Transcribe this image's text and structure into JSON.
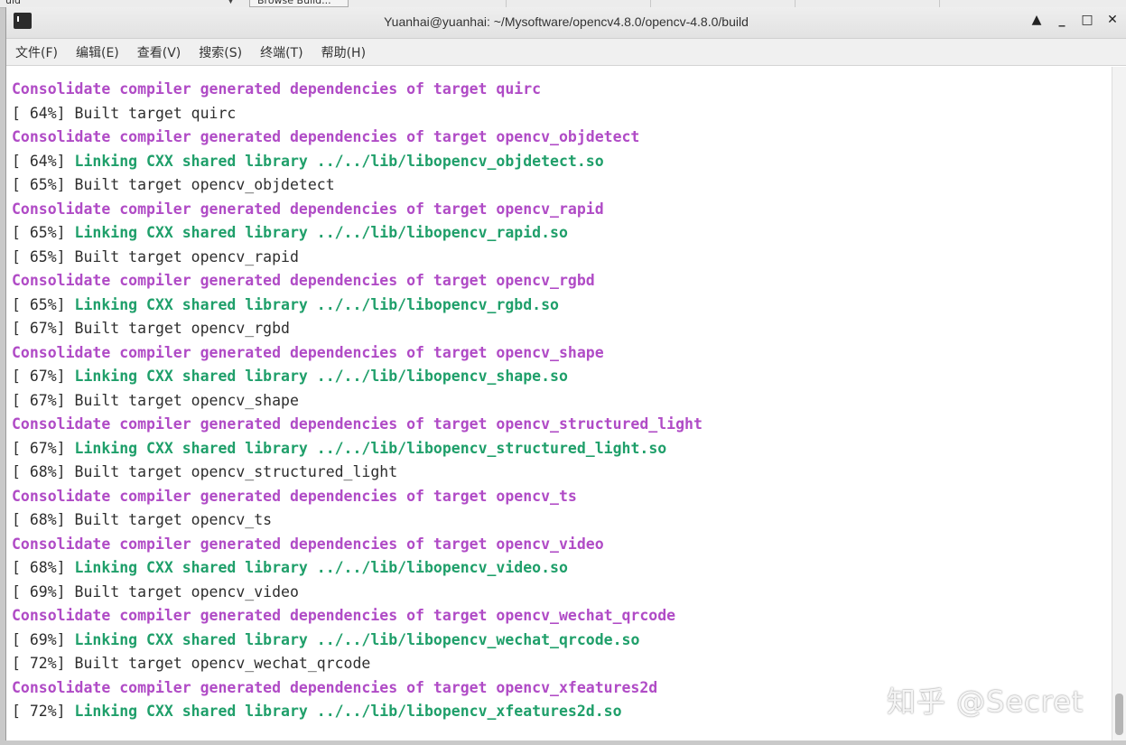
{
  "window": {
    "title": "Yuanhai@yuanhai: ~/Mysoftware/opencv4.8.0/opencv-4.8.0/build",
    "controls": {
      "shade": "▲",
      "minimize": "_",
      "maximize": "□",
      "close": "✕"
    }
  },
  "background_window": {
    "left_text": "uld",
    "button_label": "Browse Build..."
  },
  "menu": [
    {
      "label": "文件(F)"
    },
    {
      "label": "编辑(E)"
    },
    {
      "label": "查看(V)"
    },
    {
      "label": "搜索(S)"
    },
    {
      "label": "终端(T)"
    },
    {
      "label": "帮助(H)"
    }
  ],
  "terminal": {
    "colors": {
      "consolidate": "#b04bc6",
      "linking": "#1f9f6a",
      "plain": "#2e2e2e"
    },
    "lines": [
      {
        "type": "consolidate",
        "prefix": "",
        "text": "Consolidate compiler generated dependencies of target quirc"
      },
      {
        "type": "built",
        "prefix": "[ 64%] ",
        "text": "Built target quirc"
      },
      {
        "type": "consolidate",
        "prefix": "",
        "text": "Consolidate compiler generated dependencies of target opencv_objdetect"
      },
      {
        "type": "linking",
        "prefix": "[ 64%] ",
        "text": "Linking CXX shared library ../../lib/libopencv_objdetect.so"
      },
      {
        "type": "built",
        "prefix": "[ 65%] ",
        "text": "Built target opencv_objdetect"
      },
      {
        "type": "consolidate",
        "prefix": "",
        "text": "Consolidate compiler generated dependencies of target opencv_rapid"
      },
      {
        "type": "linking",
        "prefix": "[ 65%] ",
        "text": "Linking CXX shared library ../../lib/libopencv_rapid.so"
      },
      {
        "type": "built",
        "prefix": "[ 65%] ",
        "text": "Built target opencv_rapid"
      },
      {
        "type": "consolidate",
        "prefix": "",
        "text": "Consolidate compiler generated dependencies of target opencv_rgbd"
      },
      {
        "type": "linking",
        "prefix": "[ 65%] ",
        "text": "Linking CXX shared library ../../lib/libopencv_rgbd.so"
      },
      {
        "type": "built",
        "prefix": "[ 67%] ",
        "text": "Built target opencv_rgbd"
      },
      {
        "type": "consolidate",
        "prefix": "",
        "text": "Consolidate compiler generated dependencies of target opencv_shape"
      },
      {
        "type": "linking",
        "prefix": "[ 67%] ",
        "text": "Linking CXX shared library ../../lib/libopencv_shape.so"
      },
      {
        "type": "built",
        "prefix": "[ 67%] ",
        "text": "Built target opencv_shape"
      },
      {
        "type": "consolidate",
        "prefix": "",
        "text": "Consolidate compiler generated dependencies of target opencv_structured_light"
      },
      {
        "type": "linking",
        "prefix": "[ 67%] ",
        "text": "Linking CXX shared library ../../lib/libopencv_structured_light.so"
      },
      {
        "type": "built",
        "prefix": "[ 68%] ",
        "text": "Built target opencv_structured_light"
      },
      {
        "type": "consolidate",
        "prefix": "",
        "text": "Consolidate compiler generated dependencies of target opencv_ts"
      },
      {
        "type": "built",
        "prefix": "[ 68%] ",
        "text": "Built target opencv_ts"
      },
      {
        "type": "consolidate",
        "prefix": "",
        "text": "Consolidate compiler generated dependencies of target opencv_video"
      },
      {
        "type": "linking",
        "prefix": "[ 68%] ",
        "text": "Linking CXX shared library ../../lib/libopencv_video.so"
      },
      {
        "type": "built",
        "prefix": "[ 69%] ",
        "text": "Built target opencv_video"
      },
      {
        "type": "consolidate",
        "prefix": "",
        "text": "Consolidate compiler generated dependencies of target opencv_wechat_qrcode"
      },
      {
        "type": "linking",
        "prefix": "[ 69%] ",
        "text": "Linking CXX shared library ../../lib/libopencv_wechat_qrcode.so"
      },
      {
        "type": "built",
        "prefix": "[ 72%] ",
        "text": "Built target opencv_wechat_qrcode"
      },
      {
        "type": "consolidate",
        "prefix": "",
        "text": "Consolidate compiler generated dependencies of target opencv_xfeatures2d"
      },
      {
        "type": "linking",
        "prefix": "[ 72%] ",
        "text": "Linking CXX shared library ../../lib/libopencv_xfeatures2d.so"
      }
    ]
  },
  "watermark": "知乎 @Secret"
}
